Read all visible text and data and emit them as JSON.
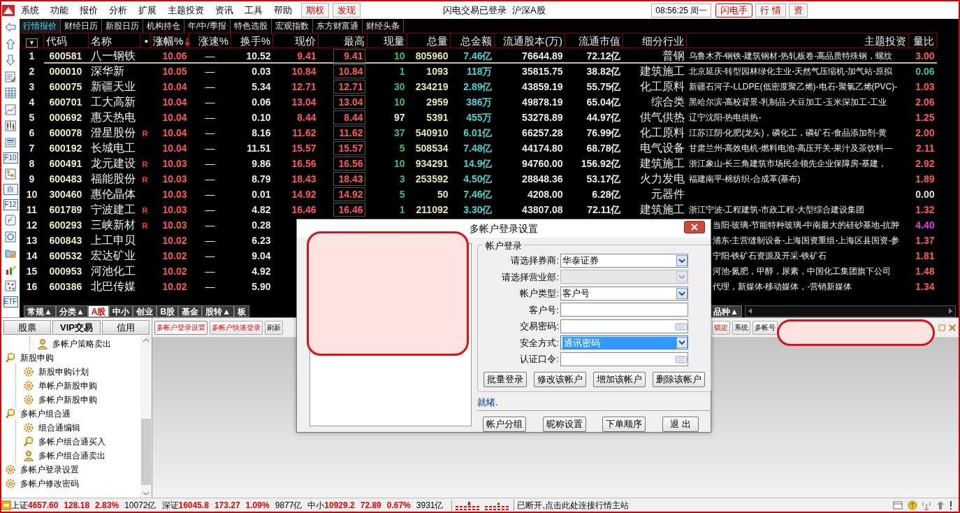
{
  "menu": [
    "系统",
    "功能",
    "报价",
    "分析",
    "扩展",
    "主题投资",
    "资讯",
    "工具",
    "帮助"
  ],
  "menu_flags": [
    "期权",
    "发现"
  ],
  "login_status": "闪电交易已登录",
  "market": "沪深A股",
  "clock": "08:56:25 周一",
  "quick_buttons": [
    {
      "label": "闪电手",
      "kind": "outlined"
    },
    {
      "label": "行 情",
      "kind": "plain"
    },
    {
      "label": "资",
      "kind": "plain"
    }
  ],
  "tabs": [
    {
      "label": "行情报价",
      "selected": true
    },
    {
      "label": "财经日历",
      "selected": false
    },
    {
      "label": "新股日历",
      "selected": false
    },
    {
      "label": "机构持仓",
      "selected": false
    },
    {
      "label": "年/中/季报",
      "selected": false
    },
    {
      "label": "特色选股",
      "selected": false
    },
    {
      "label": "宏观指数",
      "selected": false
    },
    {
      "label": "东方财富通",
      "selected": false
    },
    {
      "label": "财经头条",
      "selected": false
    }
  ],
  "side_tools": [
    {
      "kind": "arrow-left"
    },
    {
      "kind": "arrow-up"
    },
    {
      "kind": "arrow-down"
    },
    {
      "kind": "report"
    },
    {
      "kind": "grid"
    },
    {
      "kind": "line-chart"
    },
    {
      "kind": "candles"
    },
    {
      "kind": "list"
    },
    {
      "kind": "label",
      "text": "F10"
    },
    {
      "kind": "tree"
    },
    {
      "kind": "label",
      "text": "自"
    },
    {
      "kind": "label",
      "text": "F12"
    },
    {
      "kind": "formula"
    },
    {
      "kind": "circle"
    },
    {
      "kind": "folder"
    },
    {
      "kind": "bar-arrow"
    },
    {
      "kind": "scatter"
    },
    {
      "kind": "label",
      "text": "ETF"
    }
  ],
  "table": {
    "columns": [
      {
        "label": "▼",
        "sorted": false
      },
      {
        "label": "代码",
        "sorted": false
      },
      {
        "label": "名称",
        "sorted": false
      },
      {
        "label": "•",
        "sorted": false
      },
      {
        "label": "涨幅%",
        "sorted": true
      },
      {
        "label": "涨速%",
        "sorted": false
      },
      {
        "label": "换手%",
        "sorted": false
      },
      {
        "label": "现价",
        "sorted": false
      },
      {
        "label": "最高",
        "sorted": false
      },
      {
        "label": "现量",
        "sorted": false
      },
      {
        "label": "总量",
        "sorted": false
      },
      {
        "label": "总金额",
        "sorted": false
      },
      {
        "label": "流通股本(万)",
        "sorted": false
      },
      {
        "label": "流通市值",
        "sorted": false
      },
      {
        "label": "细分行业",
        "sorted": false
      },
      {
        "label": "主题投资",
        "sorted": false
      },
      {
        "label": "量比",
        "sorted": false
      }
    ],
    "rows": [
      {
        "selected": true,
        "no": "1",
        "code": "600581",
        "name": "八一钢铁",
        "change": "10.06",
        "speed": "—",
        "turnover": "10.52",
        "price": "9.41",
        "high": "9.41",
        "volume": {
          "text": "10",
          "color": "#3cc070"
        },
        "total": "805960",
        "amount": "7.46亿",
        "float_shares": "76644.89",
        "market_cap": "72.12亿",
        "industry": "普钢",
        "theme": "乌鲁木齐-钢铁-建筑钢材-热轧板卷-高品质特殊钢，螺纹",
        "ratio": {
          "text": "3.00",
          "color": "#ff5a5a"
        }
      },
      {
        "selected": false,
        "no": "2",
        "code": "000010",
        "name": "深华新",
        "change": "10.05",
        "speed": "—",
        "turnover": "0.03",
        "price": "10.84",
        "high": "10.84",
        "volume": {
          "text": "1",
          "color": "#3cc070"
        },
        "total": "1093",
        "amount": "118万",
        "float_shares": "35815.75",
        "market_cap": "38.82亿",
        "industry": "建筑施工",
        "theme": "北京延庆-转型园林绿化主业-天然气压缩机-加气站-原拟",
        "ratio": {
          "text": "0.06",
          "color": "#40c0a0"
        }
      },
      {
        "selected": false,
        "no": "3",
        "code": "600075",
        "name": "新疆天业",
        "change": "10.04",
        "speed": "—",
        "turnover": "5.34",
        "price": "12.71",
        "high": "12.71",
        "volume": {
          "text": "30",
          "color": "#3cc070"
        },
        "total": "234219",
        "amount": "2.89亿",
        "float_shares": "43859.19",
        "market_cap": "55.75亿",
        "industry": "化工原料",
        "theme": "新疆石河子-LLDPE(低密度聚乙烯)-电石-聚氯乙烯(PVC)-",
        "ratio": {
          "text": "1.03",
          "color": "#ff5a5a"
        }
      },
      {
        "selected": false,
        "no": "4",
        "code": "600701",
        "name": "工大高新",
        "change": "10.04",
        "speed": "—",
        "turnover": "0.06",
        "price": "13.04",
        "high": "13.04",
        "volume": {
          "text": "10",
          "color": "#3cc070"
        },
        "total": "2959",
        "amount": "386万",
        "float_shares": "49878.19",
        "market_cap": "65.04亿",
        "industry": "综合类",
        "theme": "黑哈尔滨-高校背景-乳制品-大豆加工-玉米深加工-工业",
        "ratio": {
          "text": "2.06",
          "color": "#ff5a5a"
        }
      },
      {
        "selected": false,
        "no": "5",
        "code": "000692",
        "name": "惠天热电",
        "change": "10.04",
        "speed": "—",
        "turnover": "0.10",
        "price": "8.44",
        "high": "8.44",
        "volume": {
          "text": "97",
          "color": "#ececec"
        },
        "total": "5391",
        "amount": "455万",
        "float_shares": "53278.89",
        "market_cap": "44.97亿",
        "industry": "供气供热",
        "theme": "辽宁沈阳-热电供热-",
        "ratio": {
          "text": "1.25",
          "color": "#ff5a5a"
        }
      },
      {
        "selected": false,
        "no": "6",
        "code": "600078",
        "name": "澄星股份",
        "flag": "R",
        "change": "10.04",
        "speed": "—",
        "turnover": "8.16",
        "price": "11.62",
        "high": "11.62",
        "volume": {
          "text": "37",
          "color": "#3cc070"
        },
        "total": "540910",
        "amount": "6.01亿",
        "float_shares": "66257.28",
        "market_cap": "76.99亿",
        "industry": "化工原料",
        "theme": "江苏江阴-化肥(龙头)，磷化工，磷矿石-食品添加剂-黄",
        "ratio": {
          "text": "2.00",
          "color": "#ff5a5a"
        }
      },
      {
        "selected": false,
        "no": "7",
        "code": "600192",
        "name": "长城电工",
        "change": "10.04",
        "speed": "—",
        "turnover": "11.51",
        "price": "15.57",
        "high": "15.57",
        "volume": {
          "text": "5",
          "color": "#3cc070"
        },
        "total": "508534",
        "amount": "7.48亿",
        "float_shares": "44174.80",
        "market_cap": "68.78亿",
        "industry": "电气设备",
        "theme": "甘肃兰州-高效电机-燃料电池-高压开关-果汁及茶饮料—",
        "ratio": {
          "text": "2.11",
          "color": "#ff5a5a"
        }
      },
      {
        "selected": false,
        "no": "8",
        "code": "600491",
        "name": "龙元建设",
        "flag": "R",
        "change": "10.03",
        "speed": "—",
        "turnover": "9.86",
        "price": "16.56",
        "high": "16.56",
        "volume": {
          "text": "10",
          "color": "#3cc070"
        },
        "total": "934291",
        "amount": "14.9亿",
        "float_shares": "94760.00",
        "market_cap": "156.92亿",
        "industry": "建筑施工",
        "theme": "浙江象山-长三角建筑市场民企领先企业保障房-基建，",
        "ratio": {
          "text": "2.92",
          "color": "#ff5a5a"
        }
      },
      {
        "selected": false,
        "no": "9",
        "code": "600483",
        "name": "福能股份",
        "flag": "R",
        "change": "10.03",
        "speed": "—",
        "turnover": "8.79",
        "price": "18.43",
        "high": "18.43",
        "volume": {
          "text": "3",
          "color": "#3cc070"
        },
        "total": "253592",
        "amount": "4.50亿",
        "float_shares": "28848.36",
        "market_cap": "53.17亿",
        "industry": "火力发电",
        "theme": "福建南平-棉纺织-合成革(基布)",
        "ratio": {
          "text": "1.89",
          "color": "#ff5a5a"
        }
      },
      {
        "selected": false,
        "no": "10",
        "code": "300460",
        "name": "惠伦晶体",
        "change": "10.03",
        "speed": "—",
        "turnover": "0.01",
        "price": "14.92",
        "high": "14.92",
        "volume": {
          "text": "5",
          "color": "#3cc070"
        },
        "total": "50",
        "amount": "7.46亿",
        "float_shares": "4208.00",
        "market_cap": "6.28亿",
        "industry": "元器件",
        "ratio": {
          "text": "0.00",
          "color": "#e0e0e0"
        }
      },
      {
        "selected": false,
        "no": "11",
        "code": "601789",
        "name": "宁波建工",
        "flag": "R",
        "change": "10.03",
        "speed": "—",
        "turnover": "4.82",
        "price": "16.46",
        "high": "16.46",
        "volume": {
          "text": "1",
          "color": "#3cc070"
        },
        "total": "211092",
        "amount": "3.30亿",
        "float_shares": "43807.08",
        "market_cap": "72.11亿",
        "industry": "建筑施工",
        "theme": "浙江宁波-工程建筑-市政工程-大型综合建设集团",
        "ratio": {
          "text": "1.32",
          "color": "#ff5a5a"
        }
      },
      {
        "selected": false,
        "no": "12",
        "code": "600293",
        "name": "三峡新材",
        "flag": "R",
        "change": "10.03",
        "speed": "—",
        "turnover": "0.28",
        "theme": "当阳-玻璃-节能特种玻璃-中南最大的硅砂基地-抗肿",
        "ratio": {
          "text": "4.40",
          "color": "#e040e0"
        }
      },
      {
        "selected": false,
        "no": "13",
        "code": "600843",
        "name": "上工申贝",
        "change": "10.02",
        "speed": "—",
        "turnover": "6.23",
        "theme": "浦东-主营缝制设备-上海国资重组-上海区县国资-参",
        "ratio": {
          "text": "1.37",
          "color": "#ff5a5a"
        }
      },
      {
        "selected": false,
        "no": "14",
        "code": "600532",
        "name": "宏达矿业",
        "change": "10.02",
        "speed": "—",
        "turnover": "9.04",
        "theme": "宁阳-铁矿石资源及开采-铁矿石",
        "ratio": {
          "text": "1.81",
          "color": "#ff5a5a"
        }
      },
      {
        "selected": false,
        "no": "15",
        "code": "000953",
        "name": "河池化工",
        "change": "10.02",
        "speed": "—",
        "turnover": "4.92",
        "theme": "河池-氮肥，甲醇，尿素，中国化工集团旗下公司",
        "ratio": {
          "text": "1.48",
          "color": "#ff5a5a"
        }
      },
      {
        "selected": false,
        "no": "16",
        "code": "600386",
        "name": "北巴传媒",
        "change": "10.02",
        "speed": "—",
        "turnover": "5.90",
        "theme": "代理，新媒体-移动媒体，-营销新媒体",
        "ratio": {
          "text": "1.34",
          "color": "#ff5a5a"
        }
      }
    ]
  },
  "board_tabs": [
    {
      "label": "常规▲",
      "selected": false
    },
    {
      "label": "分类▲",
      "selected": false
    },
    {
      "label": "A股",
      "selected": true
    },
    {
      "label": "中小",
      "selected": false
    },
    {
      "label": "创业",
      "selected": false
    },
    {
      "label": "B股",
      "selected": false
    },
    {
      "label": "基金",
      "selected": false
    },
    {
      "label": "股转▲",
      "selected": false
    },
    {
      "label": "板",
      "selected": false
    }
  ],
  "board_tab_right": "品种▲",
  "panel_tabs": [
    {
      "label": "股票",
      "selected": false
    },
    {
      "label": "VIP交易",
      "selected": true
    },
    {
      "label": "信用",
      "selected": false
    }
  ],
  "tree": [
    {
      "children": [
        {
          "label": "多帐户策略卖出",
          "kind": "person"
        }
      ]
    },
    {
      "label": "新股申购",
      "kind": "magnifier",
      "children": [
        {
          "label": "新股申购计划",
          "kind": "gear"
        },
        {
          "label": "单帐户新股申购",
          "kind": "gear"
        },
        {
          "label": "多帐户新股申购",
          "kind": "gear"
        }
      ]
    },
    {
      "label": "多帐户组合通",
      "kind": "magnifier",
      "children": [
        {
          "label": "组合通编辑",
          "kind": "gear"
        },
        {
          "label": "多帐户组合通买入",
          "kind": "magnifier"
        },
        {
          "label": "多帐户组合通卖出",
          "kind": "person"
        }
      ]
    },
    {
      "label": "多帐户登录设置",
      "kind": "gear"
    },
    {
      "label": "多帐户修改密码",
      "kind": "gear"
    }
  ],
  "toolbar": [
    {
      "label": "多帐户登录设置",
      "selected": true
    },
    {
      "label": "多帐户快速登录",
      "selected": false
    },
    {
      "label": "刷新",
      "selected": false
    }
  ],
  "toolbar_right": [
    {
      "label": "锁定",
      "kind": "alert"
    },
    {
      "label": "系统",
      "kind": "plain"
    },
    {
      "label": "多帐号",
      "kind": "plain"
    }
  ],
  "dialog": {
    "title": "多帐户登录设置",
    "group": "帐户登录",
    "fields": [
      {
        "label": "请选择券商:",
        "kind": "select",
        "value": "华泰证券",
        "disabled": false,
        "focused": false
      },
      {
        "label": "请选择营业部:",
        "kind": "select",
        "disabled": true,
        "focused": false
      },
      {
        "label": "帐户类型:",
        "kind": "select",
        "value": "客户号",
        "disabled": false,
        "focused": false
      },
      {
        "label": "客户号:",
        "kind": "text",
        "disabled": false,
        "focused": false
      },
      {
        "label": "交易密码:",
        "kind": "password",
        "disabled": false,
        "focused": false
      },
      {
        "label": "安全方式:",
        "kind": "select",
        "value": "通讯密码",
        "disabled": false,
        "focused": true
      },
      {
        "label": "认证口令:",
        "kind": "password",
        "disabled": false,
        "focused": false
      }
    ],
    "actions": [
      "批量登录",
      "修改该帐户",
      "增加该帐户",
      "删除该帐户"
    ],
    "status": "就绪.",
    "buttons": [
      "帐户分组",
      "昵称设置",
      "下单顺序",
      "退 出"
    ]
  },
  "status_bar": {
    "indices": [
      {
        "name": "上证",
        "value": "4657.60",
        "change": "128.18",
        "percent": "2.83%",
        "amount": "10072亿"
      },
      {
        "name": "深证",
        "value": "16045.8",
        "change": "173.27",
        "percent": "1.09%",
        "amount": "9877亿"
      },
      {
        "name": "中小",
        "value": "10929.2",
        "change": "72.89",
        "percent": "0.67%",
        "amount": "3931亿"
      }
    ],
    "message": "已断开,点击此处连接行情主站"
  }
}
